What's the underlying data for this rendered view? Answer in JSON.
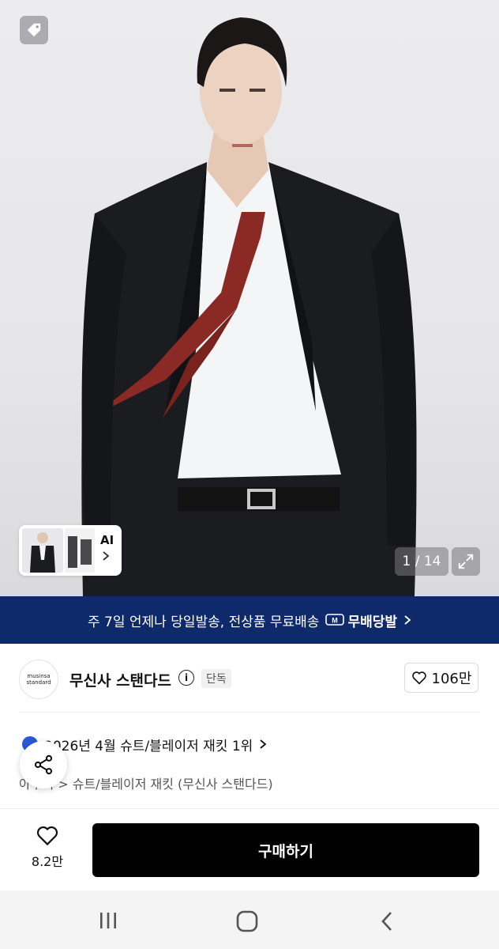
{
  "hero": {
    "counter": "1 / 14",
    "ai_label": "AI"
  },
  "banner": {
    "text": "주 7일 언제나 당일발송, 전상품 무료배송",
    "badge": "무배당발",
    "badge_letter": "M"
  },
  "brand": {
    "logo_line1": "musinsa",
    "logo_line2": "standard",
    "name": "무신사 스탠다드",
    "exclusive": "단독",
    "likes": "106만"
  },
  "ranking": {
    "text": "2026년 4월 슈트/블레이저 재킷 1위"
  },
  "breadcrumb": {
    "text": "아우터 > 슈트/블레이저 재킷 (무신사 스탠다드)"
  },
  "bottom": {
    "like_count": "8.2만",
    "buy_label": "구매하기"
  },
  "colors": {
    "banner_bg": "#0f2a6b",
    "buy_bg": "#000000",
    "rank_dot": "#2857d8"
  },
  "icons": [
    "tag-icon",
    "expand-icon",
    "chevron-right-icon",
    "info-icon",
    "heart-icon",
    "share-icon",
    "recents-icon",
    "home-icon",
    "back-icon"
  ]
}
